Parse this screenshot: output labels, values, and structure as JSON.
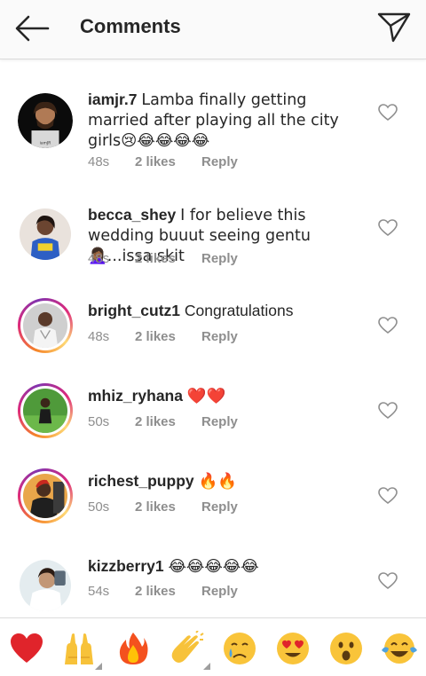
{
  "header": {
    "title": "Comments",
    "back_icon": "arrow-left-icon",
    "send_icon": "paper-plane-icon"
  },
  "comments": [
    {
      "username": "iamjr.7",
      "text": "Lamba finally getting married after playing all the city girls😢😂😂😂😂",
      "time": "48s",
      "likes": "2 likes",
      "reply": "Reply",
      "story_ring": false
    },
    {
      "username": "becca_shey",
      "text": "I for believe this wedding buuut seeing gentu 🤦🏾‍♀️...issa skit",
      "time": "48s",
      "likes": "2 likes",
      "reply": "Reply",
      "story_ring": false
    },
    {
      "username": "bright_cutz1",
      "text": "Congratulations",
      "time": "48s",
      "likes": "2 likes",
      "reply": "Reply",
      "story_ring": true
    },
    {
      "username": "mhiz_ryhana",
      "text": "❤️❤️",
      "time": "50s",
      "likes": "2 likes",
      "reply": "Reply",
      "story_ring": true
    },
    {
      "username": "richest_puppy",
      "text": "🔥🔥",
      "time": "50s",
      "likes": "2 likes",
      "reply": "Reply",
      "story_ring": true
    },
    {
      "username": "kizzberry1",
      "text": "😂😂😂😂😂",
      "time": "54s",
      "likes": "2 likes",
      "reply": "Reply",
      "story_ring": false
    }
  ],
  "emoji_bar": [
    {
      "name": "red-heart",
      "glyph": "❤️"
    },
    {
      "name": "raising-hands",
      "glyph": "🙌"
    },
    {
      "name": "fire",
      "glyph": "🔥"
    },
    {
      "name": "clapping-hands",
      "glyph": "👏"
    },
    {
      "name": "crying-face",
      "glyph": "😢"
    },
    {
      "name": "heart-eyes",
      "glyph": "😍"
    },
    {
      "name": "astonished-face",
      "glyph": "😮"
    },
    {
      "name": "tears-of-joy",
      "glyph": "😂"
    }
  ],
  "colors": {
    "text": "#262626",
    "meta": "#8e8e8e",
    "divider": "#dbdbdb",
    "heart_red": "#ed4956",
    "story_ring": [
      "#f58529",
      "#dd2a7b",
      "#8134af"
    ]
  }
}
